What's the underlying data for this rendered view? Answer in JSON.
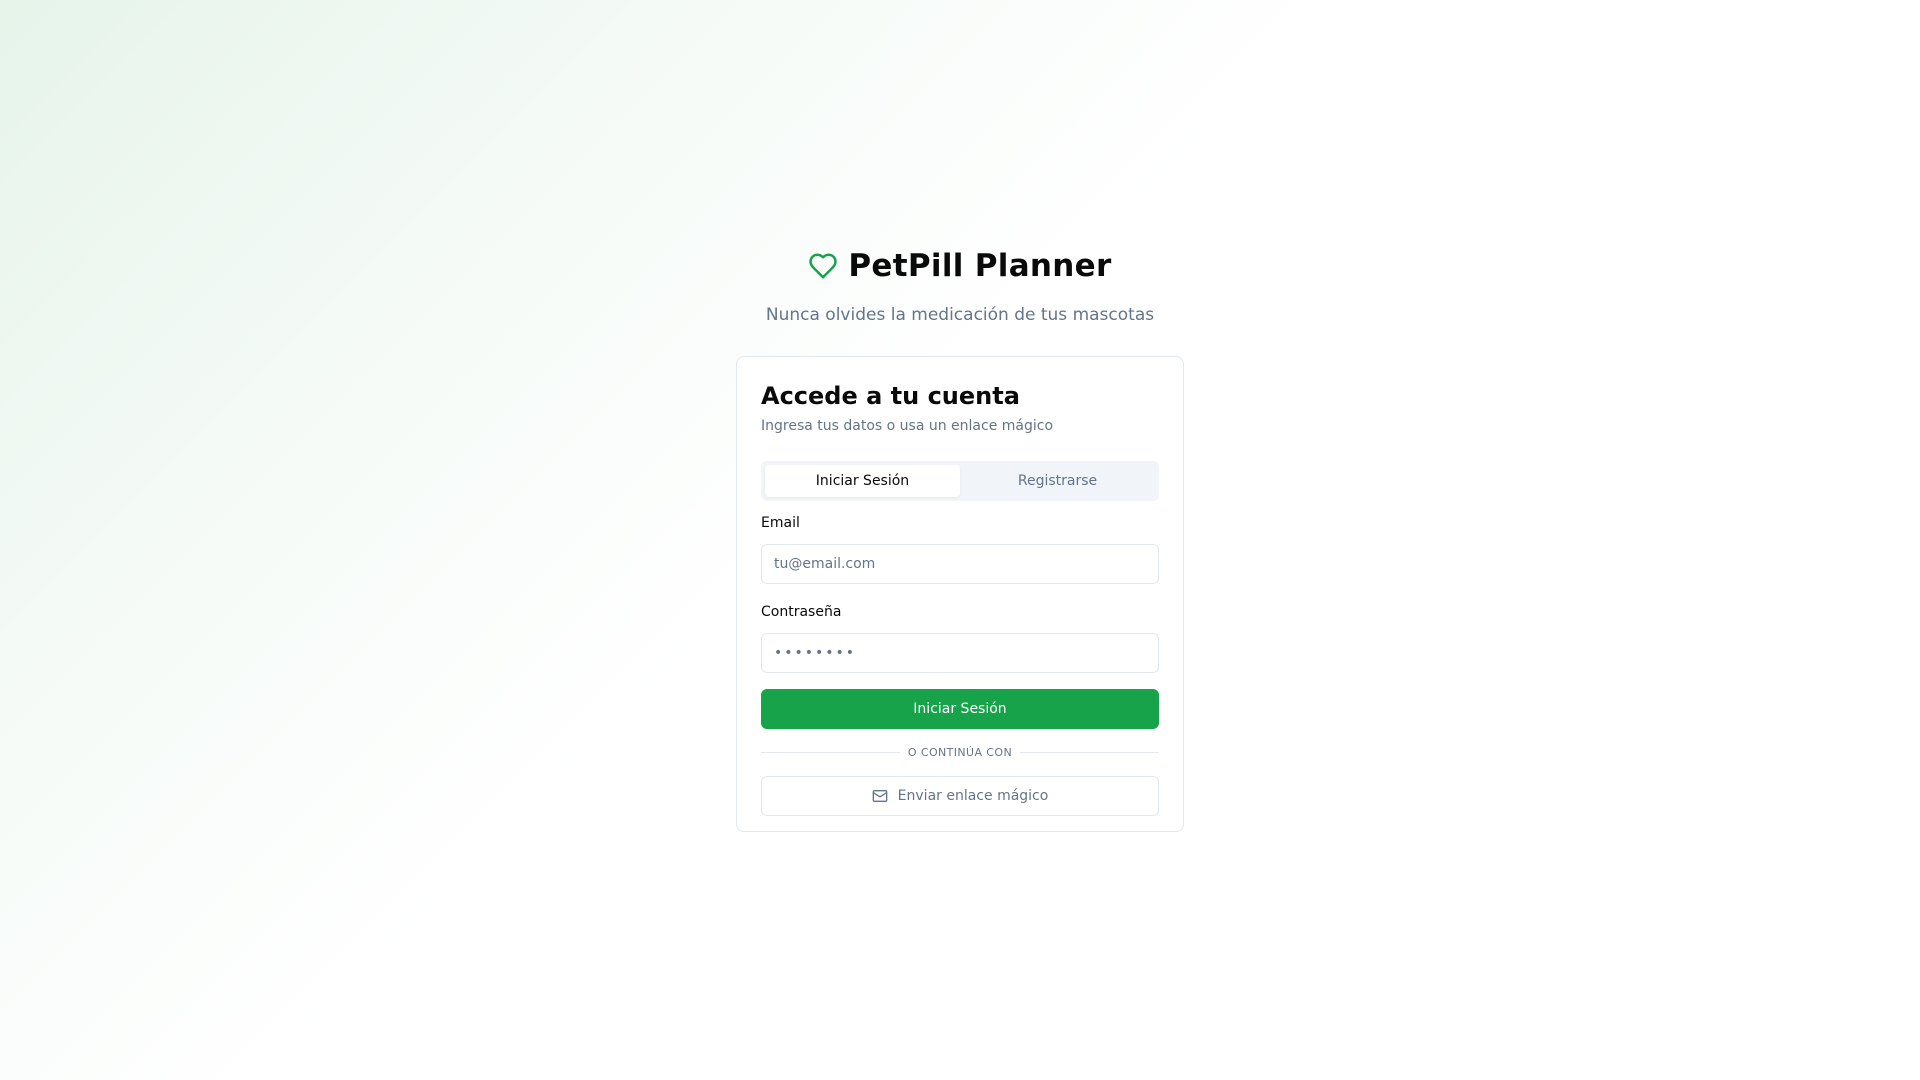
{
  "brand": {
    "title": "PetPill Planner",
    "subtitle": "Nunca olvides la medicación de tus mascotas",
    "icon": "heart-icon",
    "accent_color": "#16a34a"
  },
  "card": {
    "title": "Accede a tu cuenta",
    "description": "Ingresa tus datos o usa un enlace mágico"
  },
  "tabs": [
    {
      "label": "Iniciar Sesión",
      "active": true
    },
    {
      "label": "Registrarse",
      "active": false
    }
  ],
  "form": {
    "email_label": "Email",
    "email_placeholder": "tu@email.com",
    "email_value": "",
    "password_label": "Contraseña",
    "password_placeholder": "••••••••",
    "password_value": "",
    "submit_label": "Iniciar Sesión"
  },
  "divider_text": "O CONTINÚA CON",
  "magic_link": {
    "label": "Enviar enlace mágico",
    "icon": "mail-icon"
  }
}
